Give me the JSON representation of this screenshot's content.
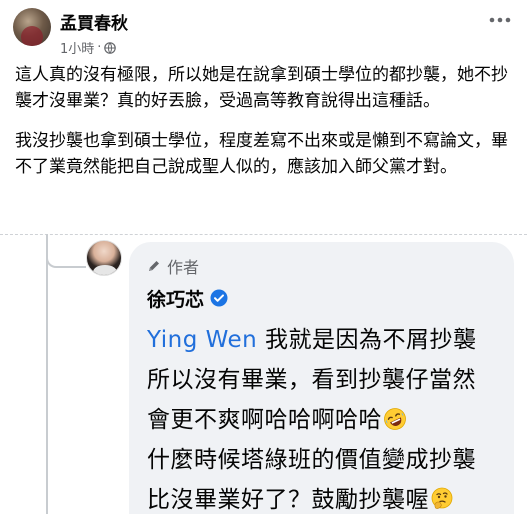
{
  "post": {
    "author": "孟買春秋",
    "time": "1小時",
    "meta_separator": "·",
    "paragraphs": [
      "這人真的沒有極限，所以她是在說拿到碩士學位的都抄襲，她不抄襲才沒畢業？真的好丟臉，受過高等教育說得出這種話。",
      "我沒抄襲也拿到碩士學位，程度差寫不出來或是懶到不寫論文，畢不了業竟然能把自己說成聖人似的，應該加入師父黨才對。"
    ]
  },
  "comment": {
    "badge": "作者",
    "name": "徐巧芯",
    "mention": "Ying Wen",
    "lines": [
      " 我就是因為不屑抄襲",
      "所以沒有畢業，看到抄襲仔當然",
      "會更不爽啊哈哈啊哈哈",
      "什麼時候塔綠班的價值變成抄襲",
      "比沒畢業好了？鼓勵抄襲喔"
    ],
    "emoji_laugh": "rolling-on-floor-laughing-emoji",
    "emoji_think": "thinking-face-emoji"
  },
  "colors": {
    "mention": "#216fdb",
    "bubble": "#f0f2f5",
    "secondary_text": "#65676b",
    "verified": "#1b74e4"
  }
}
